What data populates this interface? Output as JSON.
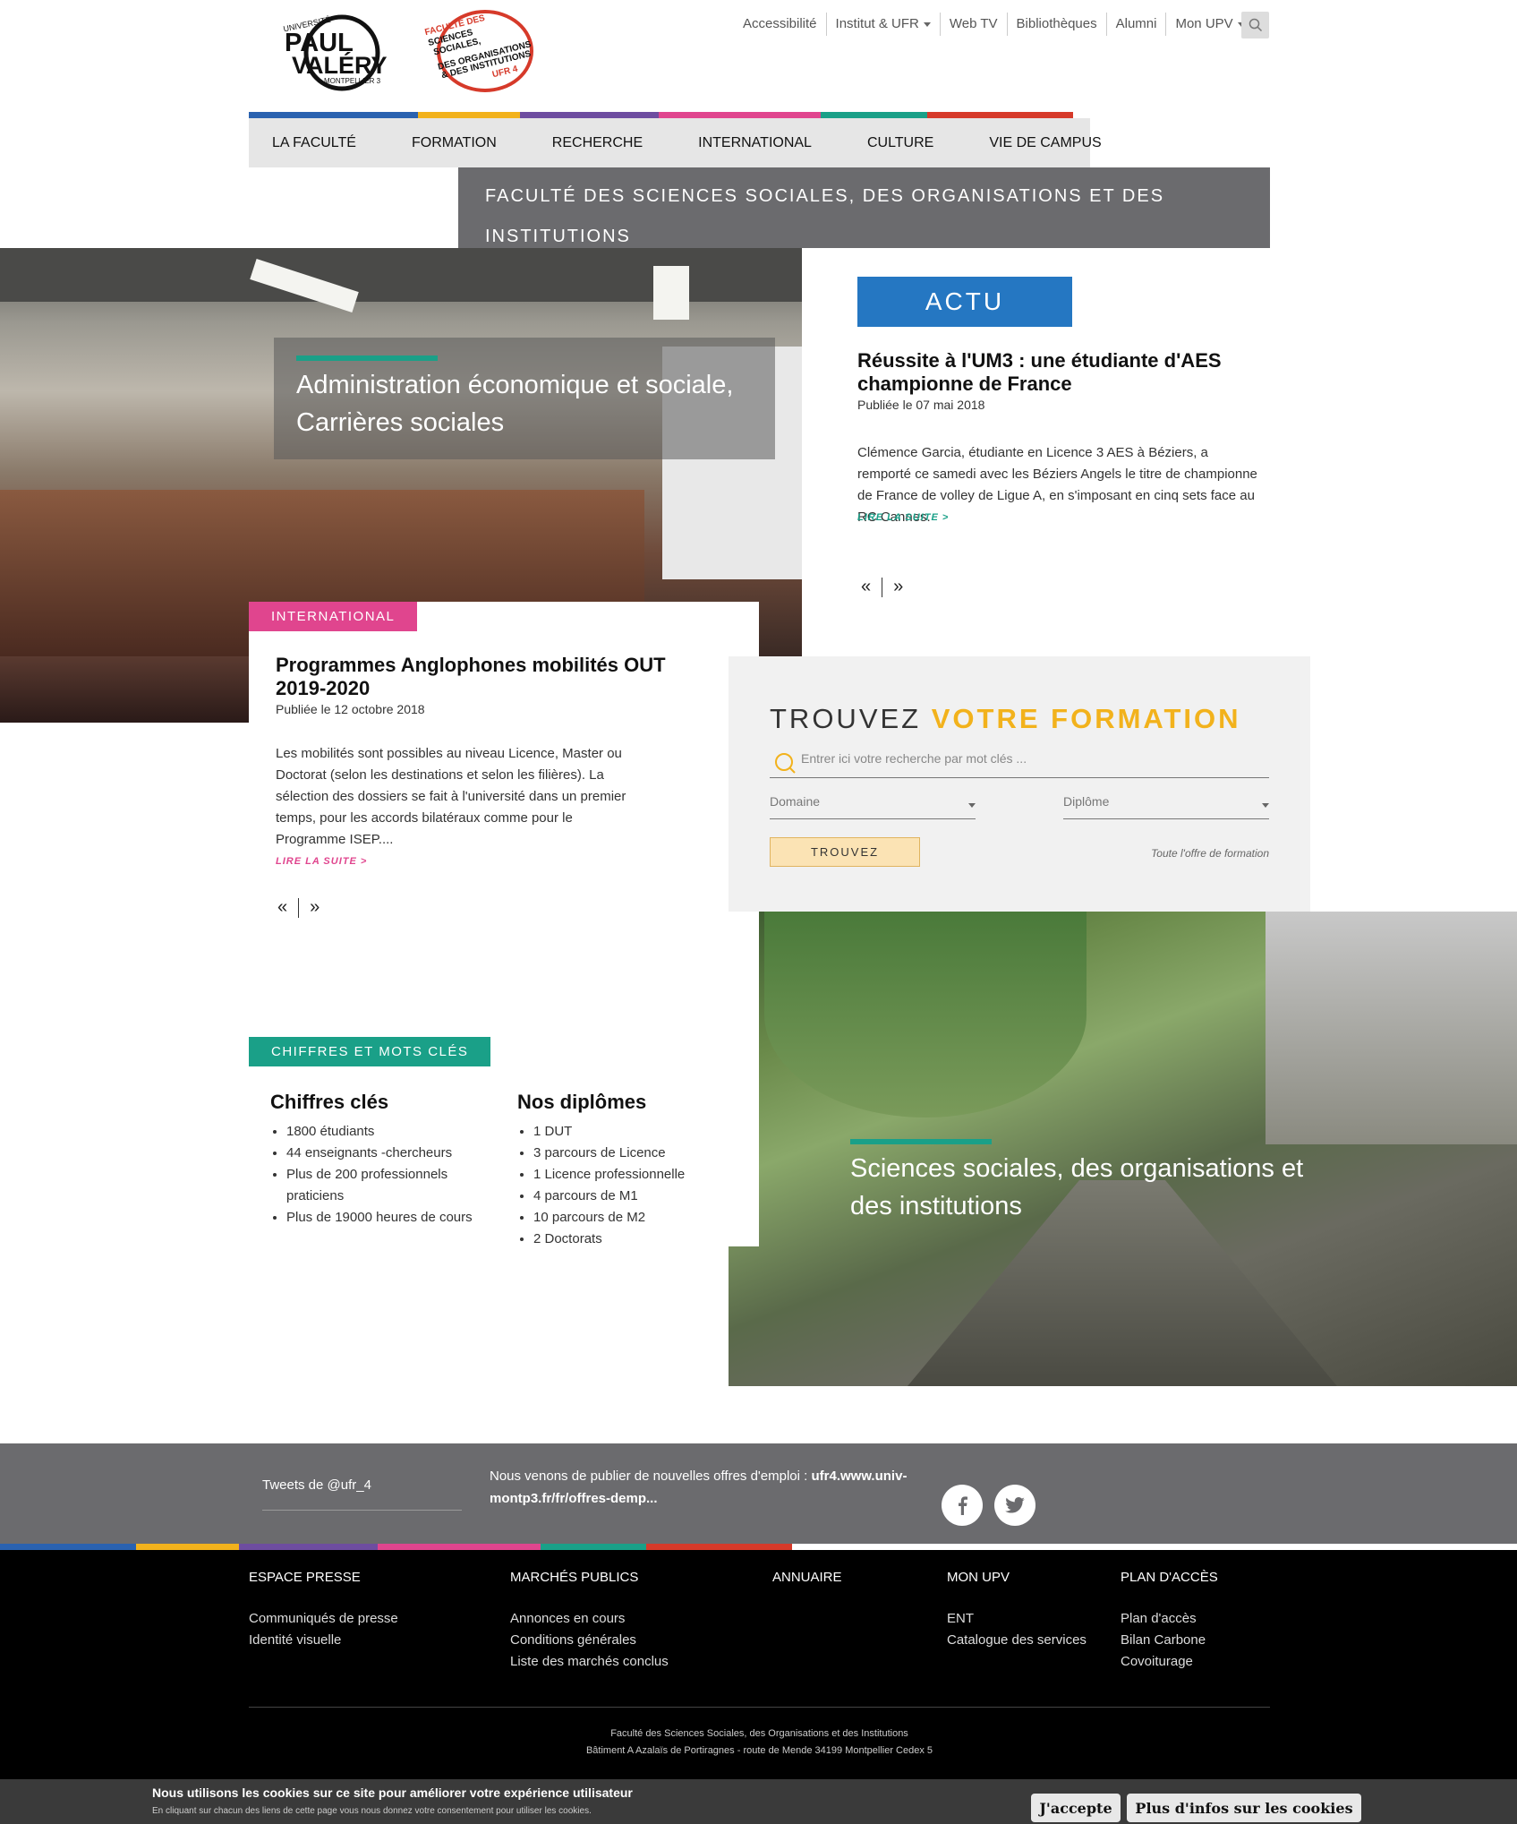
{
  "header": {
    "top_links": [
      "Accessibilité",
      "Institut & UFR",
      "Web TV",
      "Bibliothèques",
      "Alumni",
      "Mon UPV"
    ],
    "logo1": {
      "line1": "UNIVERSITÉ",
      "line2": "PAUL",
      "line3": "VALÉRY",
      "line4": "MONTPELLIER 3"
    },
    "logo2": {
      "line1": "FACULTÉ DES",
      "line2": "SCIENCES",
      "line3": "SOCIALES,",
      "line4": "DES ORGANISATIONS",
      "line5": "& DES INSTITUTIONS",
      "line6": "UFR 4"
    }
  },
  "nav": [
    "LA FACULTÉ",
    "FORMATION",
    "RECHERCHE",
    "INTERNATIONAL",
    "CULTURE",
    "VIE DE CAMPUS"
  ],
  "faculty_title": "FACULTÉ DES SCIENCES SOCIALES, DES ORGANISATIONS ET DES INSTITUTIONS",
  "hero1": {
    "title": "Administration économique et sociale, Carrières sociales"
  },
  "international": {
    "tag": "INTERNATIONAL",
    "title": "Programmes Anglophones mobilités OUT 2019-2020",
    "date": "Publiée le 12 octobre 2018",
    "text": "Les mobilités sont possibles au niveau Licence, Master ou Doctorat (selon les destinations et selon les filières). La sélection des dossiers se fait à l'université dans un premier temps, pour les accords bilatéraux comme pour le Programme ISEP....",
    "more": "LIRE LA SUITE  >"
  },
  "actu": {
    "heading": "ACTU",
    "title": "Réussite à l'UM3 : une étudiante d'AES championne de France",
    "date": "Publiée le 07 mai 2018",
    "text": "Clémence Garcia, étudiante en Licence 3 AES à Béziers, a remporté ce samedi avec les Béziers Angels le titre de championne de France de volley de Ligue A, en s'imposant en cinq sets face au RC Cannes.",
    "more": "LIRE LA SUITE  >"
  },
  "pager": {
    "prev": "«",
    "next": "»"
  },
  "formation": {
    "title_a": "TROUVEZ",
    "title_b": "VOTRE FORMATION",
    "placeholder": "Entrer ici votre recherche par mot clés ...",
    "domaine": "Domaine",
    "diplome": "Diplôme",
    "button": "TROUVEZ",
    "all_link": "Toute l'offre de formation"
  },
  "hero2": {
    "title": "Sciences sociales, des organisations et des institutions"
  },
  "chiffres": {
    "tag": "CHIFFRES ET MOTS CLÉS",
    "col1_title": "Chiffres clés",
    "col1": [
      "1800 étudiants",
      "44 enseignants -chercheurs",
      "Plus de 200 professionnels praticiens",
      "Plus de 19000 heures de cours"
    ],
    "col2_title": "Nos diplômes",
    "col2": [
      "1 DUT",
      "3 parcours de Licence",
      "1 Licence professionnelle",
      "4 parcours de M1",
      "10 parcours de M2",
      "2 Doctorats"
    ]
  },
  "tweets": {
    "label": "Tweets de @ufr_4",
    "text_plain": "Nous venons de publier de nouvelles offres d'emploi : ",
    "text_bold": "ufr4.www.univ-montp3.fr/fr/offres-demp..."
  },
  "footer": {
    "cols": [
      {
        "title": "ESPACE PRESSE",
        "links": [
          "Communiqués de presse",
          "Identité visuelle"
        ]
      },
      {
        "title": "MARCHÉS PUBLICS",
        "links": [
          "Annonces en cours",
          "Conditions générales",
          "Liste des marchés conclus"
        ]
      },
      {
        "title": "ANNUAIRE",
        "links": []
      },
      {
        "title": "MON UPV",
        "links": [
          "ENT",
          "Catalogue des services"
        ]
      },
      {
        "title": "PLAN D'ACCÈS",
        "links": [
          "Plan d'accès",
          "Bilan Carbone",
          "Covoiturage"
        ]
      }
    ],
    "address1": "Faculté des Sciences Sociales, des Organisations et des Institutions",
    "address2": "Bâtiment A Azalaïs de Portiragnes - route de Mende  34199 Montpellier Cedex 5"
  },
  "cookies": {
    "title": "Nous utilisons les cookies sur ce site pour améliorer votre expérience utilisateur",
    "subtitle": "En cliquant sur chacun des liens de cette page vous nous donnez votre consentement pour utiliser les cookies.",
    "accept": "J'accepte",
    "more": "Plus d'infos sur les cookies"
  },
  "colors": {
    "bar": [
      "#2a62b0",
      "#f2b21c",
      "#6e4da0",
      "#e0458e",
      "#1aa088",
      "#d63a2a"
    ],
    "intl": "#e0458e",
    "actu": "#2577c2",
    "green": "#1aa088",
    "gold": "#f2b21c"
  }
}
